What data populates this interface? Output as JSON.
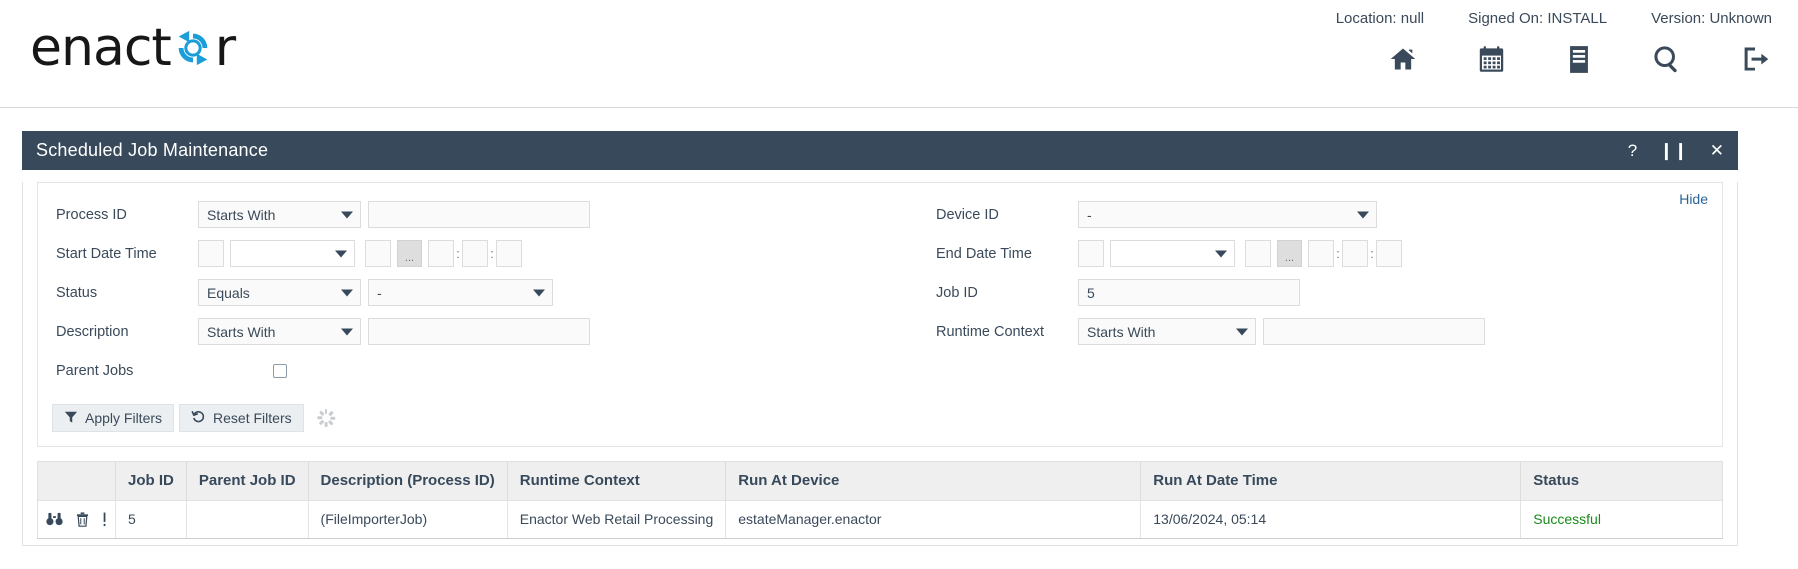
{
  "header": {
    "logo_text_left": "enact",
    "logo_text_right": "r",
    "logo_icon": "refresh-circle-icon",
    "meta": {
      "location": "Location: null",
      "signed_on": "Signed On: INSTALL",
      "version": "Version: Unknown"
    },
    "icons": [
      {
        "name": "home-icon",
        "label": "Home"
      },
      {
        "name": "calendar-icon",
        "label": "Calendar"
      },
      {
        "name": "list-icon",
        "label": "Menu"
      },
      {
        "name": "search-icon",
        "label": "Search"
      },
      {
        "name": "logout-icon",
        "label": "Sign Out"
      }
    ]
  },
  "panel": {
    "title": "Scheduled Job Maintenance",
    "controls": {
      "help": "?",
      "pause": "❙❙",
      "close": "✕"
    }
  },
  "filters": {
    "hide_label": "Hide",
    "process_id": {
      "label": "Process ID",
      "operator": "Starts With",
      "value": ""
    },
    "start_date_time": {
      "label": "Start Date Time",
      "prefix": "",
      "operator": "",
      "day": "",
      "dots": "...",
      "hour": "",
      "minute": "",
      "second": "",
      "colon": ":"
    },
    "status": {
      "label": "Status",
      "operator": "Equals",
      "value": "-"
    },
    "description": {
      "label": "Description",
      "operator": "Starts With",
      "value": ""
    },
    "parent_jobs": {
      "label": "Parent Jobs",
      "checked": false
    },
    "device_id": {
      "label": "Device ID",
      "value": "-"
    },
    "end_date_time": {
      "label": "End Date Time",
      "prefix": "",
      "operator": "",
      "day": "",
      "dots": "...",
      "hour": "",
      "minute": "",
      "second": "",
      "colon": ":"
    },
    "job_id": {
      "label": "Job ID",
      "value": "5"
    },
    "runtime_context": {
      "label": "Runtime Context",
      "operator": "Starts With",
      "value": ""
    },
    "apply_button": "Apply Filters",
    "reset_button": "Reset Filters"
  },
  "table": {
    "columns": [
      "",
      "Job ID",
      "Parent Job ID",
      "Description (Process ID)",
      "Runtime Context",
      "Run At Device",
      "Run At Date Time",
      "Status"
    ],
    "rows": [
      {
        "actions": [
          "binoculars-icon",
          "trash-icon",
          "exclamation-icon"
        ],
        "job_id": "5",
        "parent_job_id": "",
        "description": "(FileImporterJob)",
        "runtime_context": "Enactor Web Retail Processing",
        "run_at_device": "estateManager.enactor",
        "run_at_date_time": "13/06/2024, 05:14",
        "status": "Successful"
      }
    ]
  },
  "colors": {
    "panel_header": "#37495b",
    "accent_blue": "#1b9dd9",
    "link": "#2a6496",
    "status_success": "#1a8a1a"
  }
}
